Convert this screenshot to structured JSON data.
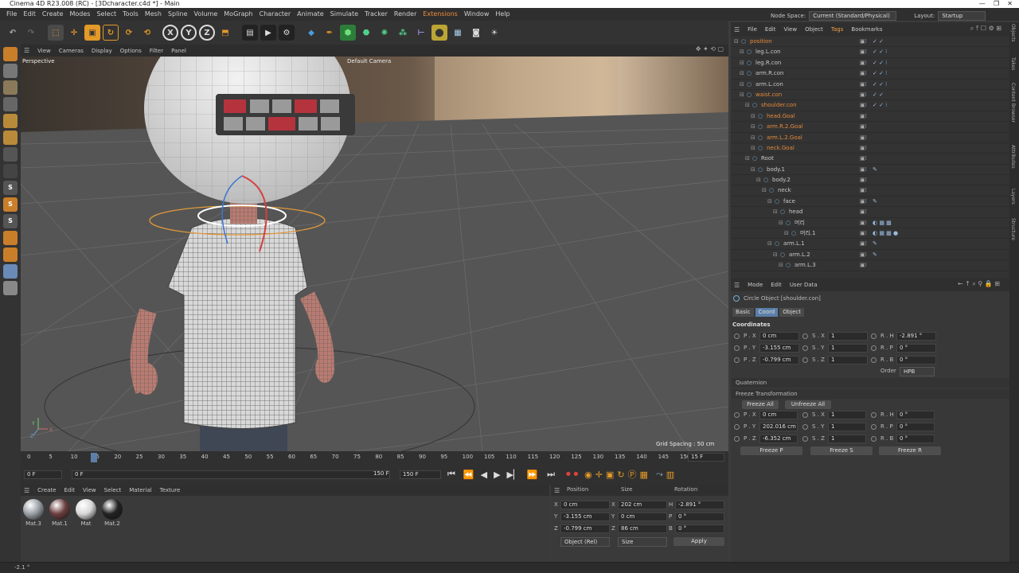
{
  "window": {
    "title": "Cinema 4D R23.008 (RC) - [3Dcharacter.c4d *] - Main"
  },
  "menu": {
    "items": [
      "File",
      "Edit",
      "Create",
      "Modes",
      "Select",
      "Tools",
      "Mesh",
      "Spline",
      "Volume",
      "MoGraph",
      "Character",
      "Animate",
      "Simulate",
      "Tracker",
      "Render",
      "Extensions",
      "Window",
      "Help"
    ],
    "node_space_label": "Node Space:",
    "node_space_value": "Current (Standard/Physical)",
    "layout_label": "Layout:",
    "layout_value": "Startup"
  },
  "toolbar": {
    "axis_x": "X",
    "axis_y": "Y",
    "axis_z": "Z"
  },
  "viewport": {
    "menu": [
      "View",
      "Cameras",
      "Display",
      "Options",
      "Filter",
      "Panel"
    ],
    "name": "Perspective",
    "camera": "Default Camera",
    "grid_spacing": "Grid Spacing : 50 cm",
    "axis_label_y": "Y",
    "axis_label_z": "Z",
    "axis_label_x": "X"
  },
  "timeline": {
    "ticks": [
      "0",
      "5",
      "10",
      "15",
      "20",
      "25",
      "30",
      "35",
      "40",
      "45",
      "50",
      "55",
      "60",
      "65",
      "70",
      "75",
      "80",
      "85",
      "90",
      "95",
      "100",
      "105",
      "110",
      "115",
      "120",
      "125",
      "130",
      "135",
      "140",
      "145",
      "150"
    ],
    "current_frame_field": "15 F",
    "start_field": "0 F",
    "start_field2": "0 F",
    "end_field": "150 F",
    "end_field2": "150 F",
    "playhead_frame": 15
  },
  "materials": {
    "menu": [
      "Create",
      "Edit",
      "View",
      "Select",
      "Material",
      "Texture"
    ],
    "items": [
      {
        "name": "Mat.3",
        "color": "#9aa0a6"
      },
      {
        "name": "Mat.1",
        "color": "#6b3f3f"
      },
      {
        "name": "Mat",
        "color": "#d8d8d8"
      },
      {
        "name": "Mat.2",
        "color": "#222222"
      }
    ]
  },
  "coords": {
    "headers": [
      "Position",
      "Size",
      "Rotation"
    ],
    "rows": [
      {
        "axis": "X",
        "pos": "0 cm",
        "size_axis": "X",
        "size": "202 cm",
        "rot_axis": "H",
        "rot": "-2.891 °"
      },
      {
        "axis": "Y",
        "pos": "-3.155 cm",
        "size_axis": "Y",
        "size": "0 cm",
        "rot_axis": "P",
        "rot": "0 °"
      },
      {
        "axis": "Z",
        "pos": "-0.799 cm",
        "size_axis": "Z",
        "size": "86 cm",
        "rot_axis": "B",
        "rot": "0 °"
      }
    ],
    "mode_dropdown": "Object (Rel)",
    "size_dropdown": "Size",
    "apply_button": "Apply"
  },
  "status": {
    "text": "-2.1 °"
  },
  "object_manager": {
    "menu": [
      "File",
      "Edit",
      "View",
      "Object",
      "Tags",
      "Bookmarks"
    ],
    "objects": [
      {
        "name": "position",
        "indent": 0,
        "selected": true,
        "tags": "✓ ✓"
      },
      {
        "name": "leg.L.con",
        "indent": 1,
        "selected": false,
        "tags": "✓ ✓ ⁝"
      },
      {
        "name": "leg.R.con",
        "indent": 1,
        "selected": false,
        "tags": "✓ ✓ ⁝"
      },
      {
        "name": "arm.R.con",
        "indent": 1,
        "selected": false,
        "tags": "✓ ✓ ⁝"
      },
      {
        "name": "arm.L.con",
        "indent": 1,
        "selected": false,
        "tags": "✓ ✓ ⁝"
      },
      {
        "name": "waist.con",
        "indent": 1,
        "selected": true,
        "tags": "✓ ✓"
      },
      {
        "name": "shoulder.con",
        "indent": 2,
        "selected": true,
        "tags": "✓ ✓ ⁝"
      },
      {
        "name": "head.Goal",
        "indent": 3,
        "selected": true,
        "tags": ""
      },
      {
        "name": "arm.R.2.Goal",
        "indent": 3,
        "selected": true,
        "tags": ""
      },
      {
        "name": "arm.L.2.Goal",
        "indent": 3,
        "selected": true,
        "tags": ""
      },
      {
        "name": "neck.Goal",
        "indent": 3,
        "selected": true,
        "tags": ""
      },
      {
        "name": "Root",
        "indent": 2,
        "selected": false,
        "tags": ""
      },
      {
        "name": "body.1",
        "indent": 3,
        "selected": false,
        "tags": "✎"
      },
      {
        "name": "body.2",
        "indent": 4,
        "selected": false,
        "tags": ""
      },
      {
        "name": "neck",
        "indent": 5,
        "selected": false,
        "tags": ""
      },
      {
        "name": "face",
        "indent": 6,
        "selected": false,
        "tags": "✎"
      },
      {
        "name": "head",
        "indent": 7,
        "selected": false,
        "tags": ""
      },
      {
        "name": "머리",
        "indent": 8,
        "selected": false,
        "tags": "◐ ▦ ▩"
      },
      {
        "name": "머리.1",
        "indent": 9,
        "selected": false,
        "tags": "◐ ▦ ▩ ●"
      },
      {
        "name": "arm.L.1",
        "indent": 6,
        "selected": false,
        "tags": "✎"
      },
      {
        "name": "arm.L.2",
        "indent": 7,
        "selected": false,
        "tags": "✎"
      },
      {
        "name": "arm.L.3",
        "indent": 8,
        "selected": false,
        "tags": ""
      }
    ]
  },
  "attributes": {
    "menu": [
      "Mode",
      "Edit",
      "User Data"
    ],
    "object_title": "Circle Object [shoulder.con]",
    "tabs": [
      "Basic",
      "Coord",
      "Object"
    ],
    "section": "Coordinates",
    "p": [
      {
        "l": "P . X",
        "v": "0 cm"
      },
      {
        "l": "P . Y",
        "v": "-3.155 cm"
      },
      {
        "l": "P . Z",
        "v": "-0.799 cm"
      }
    ],
    "s": [
      {
        "l": "S . X",
        "v": "1"
      },
      {
        "l": "S . Y",
        "v": "1"
      },
      {
        "l": "S . Z",
        "v": "1"
      }
    ],
    "r": [
      {
        "l": "R . H",
        "v": "-2.891 °"
      },
      {
        "l": "R . P",
        "v": "0 °"
      },
      {
        "l": "R . B",
        "v": "0 °"
      }
    ],
    "order_label": "Order",
    "order_value": "HPB",
    "quaternion": "Quaternion",
    "freeze": "Freeze Transformation",
    "freeze_all": "Freeze All",
    "unfreeze_all": "Unfreeze All",
    "fp": [
      {
        "l": "P . X",
        "v": "0 cm"
      },
      {
        "l": "P . Y",
        "v": "202.016 cm"
      },
      {
        "l": "P . Z",
        "v": "-6.352 cm"
      }
    ],
    "fs": [
      {
        "l": "S . X",
        "v": "1"
      },
      {
        "l": "S . Y",
        "v": "1"
      },
      {
        "l": "S . Z",
        "v": "1"
      }
    ],
    "fr": [
      {
        "l": "R . H",
        "v": "0 °"
      },
      {
        "l": "R . P",
        "v": "0 °"
      },
      {
        "l": "R . B",
        "v": "0 °"
      }
    ],
    "freeze_p": "Freeze P",
    "freeze_s": "Freeze S",
    "freeze_r": "Freeze R"
  },
  "right_tabs": [
    "Objects",
    "Takes",
    "Content Browser",
    "Attributes",
    "Layers",
    "Structure"
  ]
}
